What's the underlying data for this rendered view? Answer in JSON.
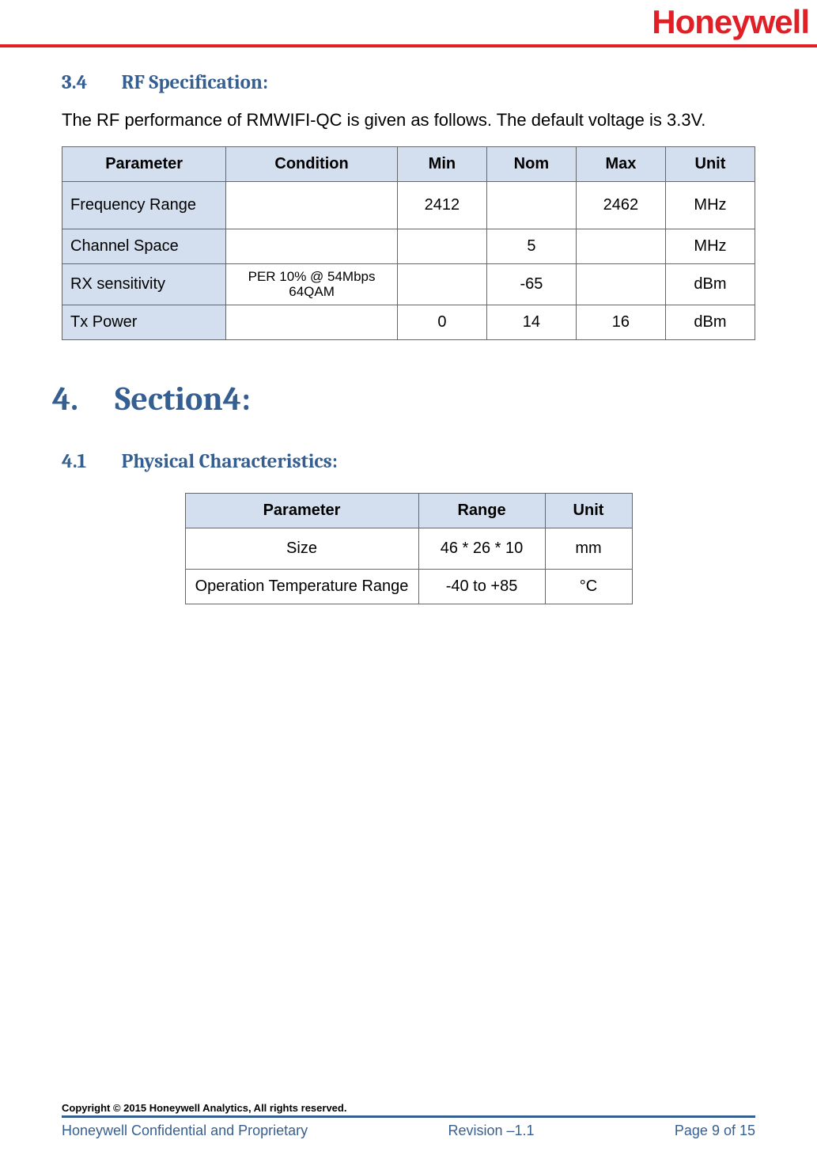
{
  "header": {
    "logo_text": "Honeywell"
  },
  "section34": {
    "number": "3.4",
    "title": "RF Specification:",
    "intro": "The RF performance of RMWIFI-QC is given as follows. The default voltage is 3.3V.",
    "table": {
      "headers": [
        "Parameter",
        "Condition",
        "Min",
        "Nom",
        "Max",
        "Unit"
      ],
      "rows": [
        {
          "param": "Frequency Range",
          "cond": "",
          "min": "2412",
          "nom": "",
          "max": "2462",
          "unit": "MHz"
        },
        {
          "param": "Channel Space",
          "cond": "",
          "min": "",
          "nom": "5",
          "max": "",
          "unit": "MHz"
        },
        {
          "param": "RX sensitivity",
          "cond": "PER 10% @ 54Mbps 64QAM",
          "min": "",
          "nom": "-65",
          "max": "",
          "unit": "dBm"
        },
        {
          "param": "Tx Power",
          "cond": "",
          "min": "0",
          "nom": "14",
          "max": "16",
          "unit": "dBm"
        }
      ]
    }
  },
  "section4": {
    "number": "4.",
    "title": "Section4:"
  },
  "section41": {
    "number": "4.1",
    "title": "Physical Characteristics:",
    "table": {
      "headers": [
        "Parameter",
        "Range",
        "Unit"
      ],
      "rows": [
        {
          "param": "Size",
          "range": "46 * 26 * 10",
          "unit": "mm"
        },
        {
          "param": "Operation Temperature Range",
          "range": "-40 to +85",
          "unit": "°C"
        }
      ]
    }
  },
  "footer": {
    "copyright": "Copyright © 2015 Honeywell Analytics, All rights reserved.",
    "left": "Honeywell Confidential and Proprietary",
    "center": "Revision –1.1",
    "right": "Page 9 of 15"
  }
}
